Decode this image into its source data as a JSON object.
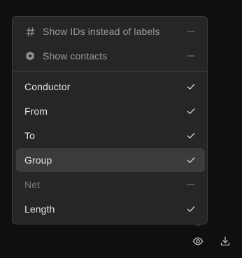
{
  "menu": {
    "options": [
      {
        "label": "Show IDs instead of labels",
        "icon": "hash-icon",
        "state": "dash"
      },
      {
        "label": "Show contacts",
        "icon": "hexagon-icon",
        "state": "dash"
      }
    ],
    "columns": [
      {
        "label": "Conductor",
        "checked": true
      },
      {
        "label": "From",
        "checked": true
      },
      {
        "label": "To",
        "checked": true
      },
      {
        "label": "Group",
        "checked": true,
        "highlighted": true
      },
      {
        "label": "Net",
        "checked": false
      },
      {
        "label": "Length",
        "checked": true
      }
    ]
  },
  "toolbar": {
    "visibility_icon": "eye-icon",
    "download_icon": "download-icon"
  },
  "colors": {
    "background": "#0f0f0f",
    "menu_bg": "#262626",
    "highlight": "#3b3b3b",
    "text_on": "#e6e6e6",
    "text_muted": "#9a9a9a",
    "text_disabled": "#7a7a7a"
  }
}
